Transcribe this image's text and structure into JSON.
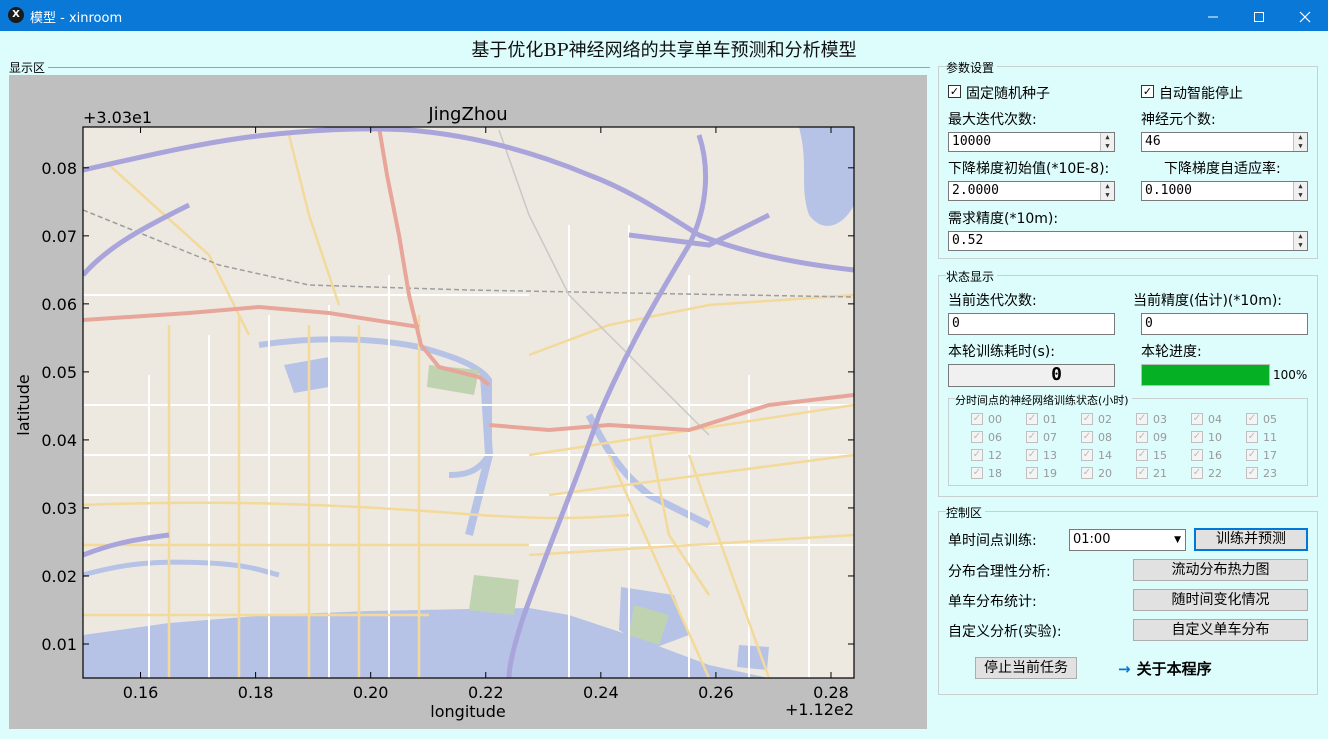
{
  "window": {
    "title": "模型 - xinroom",
    "app_icon": "X",
    "controls": [
      "minimize-icon",
      "maximize-icon",
      "close-icon"
    ]
  },
  "heading": "基于优化BP神经网络的共享单车预测和分析模型",
  "display_section": {
    "label": "显示区"
  },
  "chart_data": {
    "type": "map",
    "title": "JingZhou",
    "xlabel": "longitude",
    "ylabel": "latitude",
    "x_offset_label": "+1.12e2",
    "y_offset_label": "+3.03e1",
    "xlim": [
      0.15,
      0.284
    ],
    "ylim": [
      0.005,
      0.086
    ],
    "x_ticks": [
      0.16,
      0.18,
      0.2,
      0.22,
      0.24,
      0.26,
      0.28
    ],
    "y_ticks": [
      0.01,
      0.02,
      0.03,
      0.04,
      0.05,
      0.06,
      0.07,
      0.08
    ],
    "x_tick_labels": [
      "0.16",
      "0.18",
      "0.20",
      "0.22",
      "0.24",
      "0.26",
      "0.28"
    ],
    "y_tick_labels": [
      "0.01",
      "0.02",
      "0.03",
      "0.04",
      "0.05",
      "0.06",
      "0.07",
      "0.08"
    ],
    "colors": {
      "land": "#ede9e1",
      "water": "#b7c3e6",
      "highway": "#a9a5da",
      "trunk": "#e8a59a",
      "road": "#f3d99a",
      "park": "#bfd3b0"
    }
  },
  "params": {
    "section_label": "参数设置",
    "fixed_seed_label": "固定随机种子",
    "fixed_seed_checked": true,
    "auto_stop_label": "自动智能停止",
    "auto_stop_checked": true,
    "max_iter_label": "最大迭代次数:",
    "max_iter_value": "10000",
    "neurons_label": "神经元个数:",
    "neurons_value": "46",
    "lr_init_label": "下降梯度初始值(*10E-8):",
    "lr_init_value": "2.0000",
    "lr_adapt_label": "下降梯度自适应率:",
    "lr_adapt_value": "0.1000",
    "precision_label": "需求精度(*10m):",
    "precision_value": "0.52"
  },
  "status": {
    "section_label": "状态显示",
    "cur_iter_label": "当前迭代次数:",
    "cur_iter_value": "0",
    "cur_precision_label": "当前精度(估计)(*10m):",
    "cur_precision_value": "0",
    "time_label": "本轮训练耗时(s):",
    "time_value": "0",
    "progress_label": "本轮进度:",
    "progress_percent": 100,
    "progress_text": "100%",
    "hours_label": "分时间点的神经网络训练状态(小时)",
    "hours": [
      "00",
      "01",
      "02",
      "03",
      "04",
      "05",
      "06",
      "07",
      "08",
      "09",
      "10",
      "11",
      "12",
      "13",
      "14",
      "15",
      "16",
      "17",
      "18",
      "19",
      "20",
      "21",
      "22",
      "23"
    ]
  },
  "control": {
    "section_label": "控制区",
    "single_train_label": "单时间点训练:",
    "time_select_value": "01:00",
    "train_button": "训练并预测",
    "dist_label": "分布合理性分析:",
    "heatmap_button": "流动分布热力图",
    "stat_label": "单车分布统计:",
    "time_change_button": "随时间变化情况",
    "custom_label": "自定义分析(实验):",
    "custom_button": "自定义单车分布",
    "stop_button": "停止当前任务",
    "about_link": "关于本程序",
    "about_arrow": "→"
  }
}
